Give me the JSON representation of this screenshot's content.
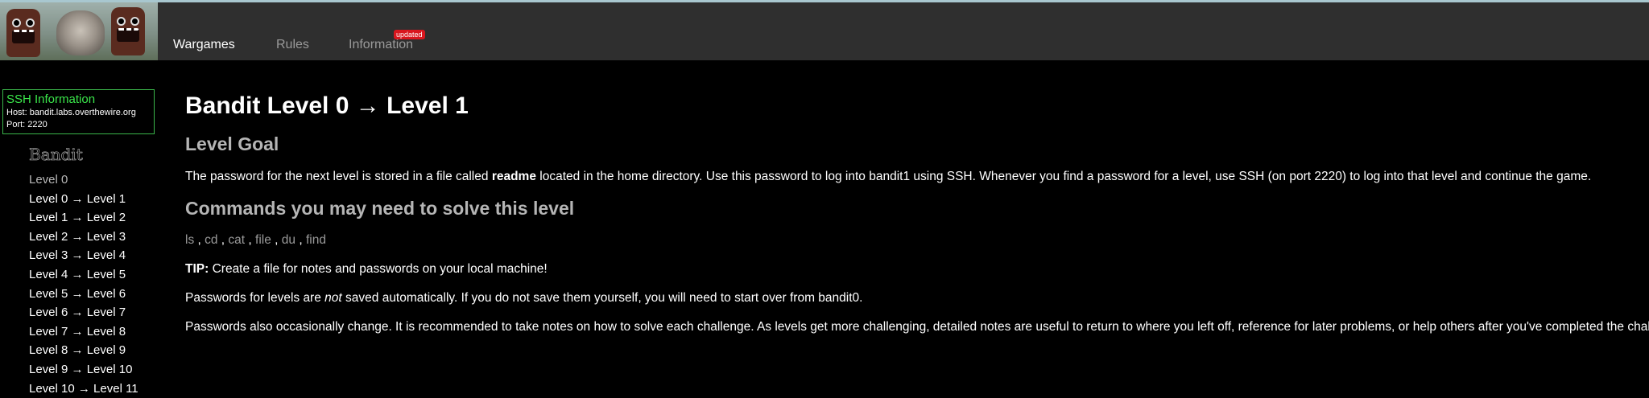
{
  "colors": {
    "background": "#000000",
    "navbar": "#2f2f2f",
    "ssh_border": "#3ab54a",
    "ssh_title": "#3ae64a",
    "badge": "#d9161e"
  },
  "logo": {
    "icon": "domo-cat-logo-image"
  },
  "nav": {
    "items": [
      {
        "label": "Wargames"
      },
      {
        "label": "Rules"
      },
      {
        "label": "Information",
        "badge": "updated"
      }
    ]
  },
  "ssh": {
    "title": "SSH Information",
    "host": "Host: bandit.labs.overthewire.org",
    "port": "Port: 2220"
  },
  "sidebar": {
    "game_title": "Bandit",
    "levels": [
      "Level 0",
      "Level 0 → Level 1",
      "Level 1 → Level 2",
      "Level 2 → Level 3",
      "Level 3 → Level 4",
      "Level 4 → Level 5",
      "Level 5 → Level 6",
      "Level 6 → Level 7",
      "Level 7 → Level 8",
      "Level 8 → Level 9",
      "Level 9 → Level 10",
      "Level 10 → Level 11"
    ]
  },
  "main": {
    "title": "Bandit Level 0 → Level 1",
    "goal_heading": "Level Goal",
    "goal_text_before": "The password for the next level is stored in a file called ",
    "goal_text_bold": "readme",
    "goal_text_after": " located in the home directory. Use this password to log into bandit1 using SSH. Whenever you find a password for a level, use SSH (on port 2220) to log into that level and continue the game.",
    "commands_heading": "Commands you may need to solve this level",
    "commands": [
      "ls",
      "cd",
      "cat",
      "file",
      "du",
      "find"
    ],
    "commands_separator": " , ",
    "tip_label": "TIP:",
    "tip_text": " Create a file for notes and passwords on your local machine!",
    "saved_before": "Passwords for levels are ",
    "saved_italic": "not",
    "saved_after": " saved automatically. If you do not save them yourself, you will need to start over from bandit0.",
    "change_text": "Passwords also occasionally change. It is recommended to take notes on how to solve each challenge. As levels get more challenging, detailed notes are useful to return to where you left off, reference for later problems, or help others after you've completed the challenge."
  }
}
